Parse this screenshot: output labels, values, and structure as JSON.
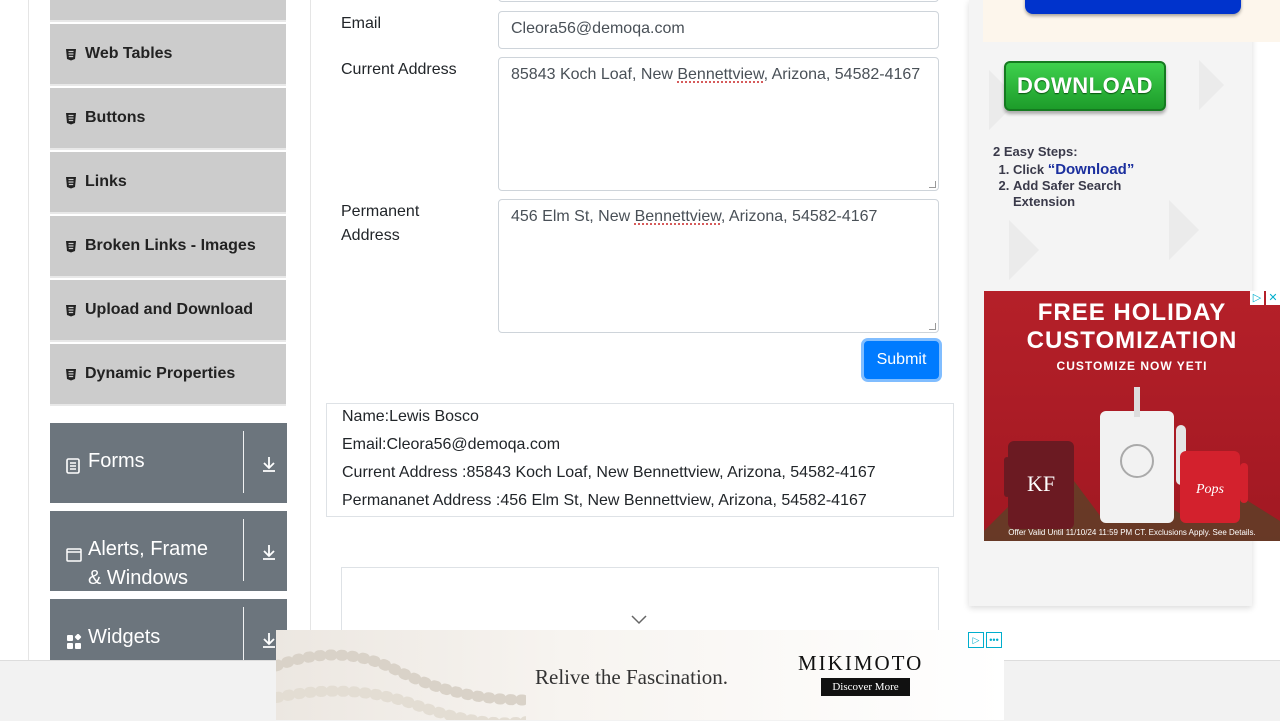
{
  "sidebar": {
    "items": [
      {
        "label": "Web Tables",
        "icon": "element-icon"
      },
      {
        "label": "Buttons",
        "icon": "element-icon"
      },
      {
        "label": "Links",
        "icon": "element-icon"
      },
      {
        "label": "Broken Links - Images",
        "icon": "element-icon"
      },
      {
        "label": "Upload and Download",
        "icon": "element-icon"
      },
      {
        "label": "Dynamic Properties",
        "icon": "element-icon"
      }
    ],
    "groups": [
      {
        "label": "Forms",
        "icon": "form-icon"
      },
      {
        "label": "Alerts, Frame & Windows",
        "icon": "window-icon"
      },
      {
        "label": "Widgets",
        "icon": "widgets-icon"
      }
    ]
  },
  "form": {
    "email_label": "Email",
    "email_value": "Cleora56@demoqa.com",
    "current_address_label": "Current Address",
    "current_address_value": {
      "pre": "85843 Koch Loaf, New ",
      "flagged": "Bennettview",
      "post": ", Arizona, 54582-4167"
    },
    "permanent_address_label": "Permanent Address",
    "permanent_address_value": {
      "pre": "456 Elm St, New ",
      "flagged": "Bennettview",
      "post": ", Arizona, 54582-4167"
    },
    "submit_label": "Submit"
  },
  "output": {
    "name": "Name:Lewis Bosco",
    "email": "Email:Cleora56@demoqa.com",
    "current_address": "Current Address :85843 Koch Loaf, New Bennettview, Arizona, 54582-4167",
    "permanent_address": "Permananet Address :456 Elm St, New Bennettview, Arizona, 54582-4167"
  },
  "ads": {
    "download": {
      "button": "DOWNLOAD",
      "steps_title": "2 Easy Steps:",
      "step1_prefix": "Click ",
      "step1_highlight": "“Download”",
      "step2": "Add Safer Search Extension"
    },
    "yeti": {
      "line1": "FREE HOLIDAY",
      "line2": "CUSTOMIZATION",
      "cta": "CUSTOMIZE NOW YETI",
      "fine_print": "Offer Valid Until 11/10/24 11:59 PM CT. Exclusions Apply. See Details."
    },
    "mikimoto": {
      "tagline": "Relive the Fascination.",
      "brand": "MIKIMOTO",
      "cta": "Discover More"
    }
  },
  "colors": {
    "accent": "#007bff",
    "sidebar_item_bg": "#cccccc",
    "group_bg": "#6c757d",
    "download_green": "#28b838"
  }
}
